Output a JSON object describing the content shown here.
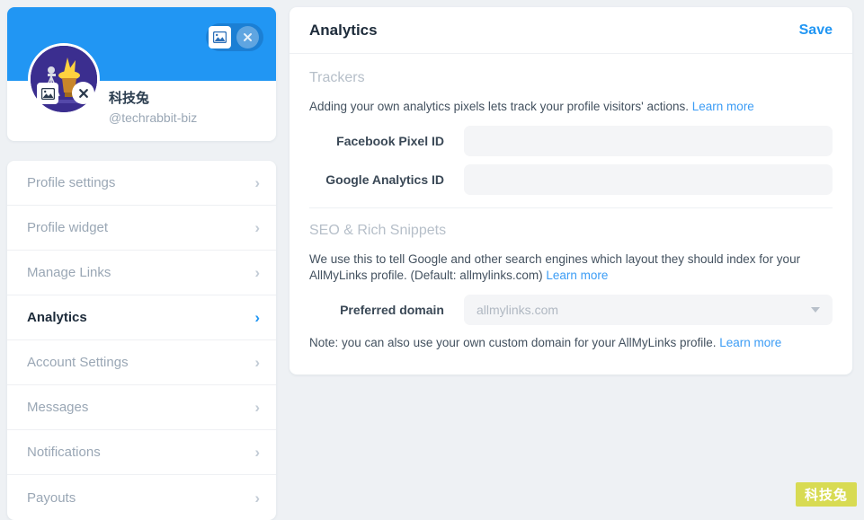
{
  "profile": {
    "display_name": "科技兔",
    "handle": "@techrabbit-biz",
    "banner_color": "#2196f3",
    "avatar_bg": "#3b2e8f",
    "banner_image_icon": "image-icon",
    "banner_remove_icon": "close-circle-icon",
    "avatar_image_icon": "image-icon",
    "avatar_remove_icon": "close-circle-icon"
  },
  "sidebar": {
    "items": [
      {
        "label": "Profile settings",
        "active": false
      },
      {
        "label": "Profile widget",
        "active": false
      },
      {
        "label": "Manage Links",
        "active": false
      },
      {
        "label": "Analytics",
        "active": true
      },
      {
        "label": "Account Settings",
        "active": false
      },
      {
        "label": "Messages",
        "active": false
      },
      {
        "label": "Notifications",
        "active": false
      },
      {
        "label": "Payouts",
        "active": false
      }
    ],
    "chevron_icon": "chevron-right-icon"
  },
  "main": {
    "title": "Analytics",
    "save_label": "Save",
    "accent_color": "#2196f3",
    "link_color": "#3b9cf5",
    "trackers": {
      "heading": "Trackers",
      "description": "Adding your own analytics pixels lets track your profile visitors' actions.",
      "learn_more": "Learn more",
      "fields": [
        {
          "label": "Facebook Pixel ID",
          "value": "",
          "placeholder": ""
        },
        {
          "label": "Google Analytics ID",
          "value": "",
          "placeholder": ""
        }
      ]
    },
    "seo": {
      "heading": "SEO & Rich Snippets",
      "description": "We use this to tell Google and other search engines which layout they should index for your AllMyLinks profile. (Default: allmylinks.com)",
      "learn_more": "Learn more",
      "domain_label": "Preferred domain",
      "domain_value": "allmylinks.com",
      "domain_caret_icon": "chevron-down-icon",
      "note": "Note: you can also use your own custom domain for your AllMyLinks profile.",
      "note_learn_more": "Learn more"
    }
  },
  "watermark": {
    "text": "科技兔",
    "bg_color": "#d8db53"
  }
}
